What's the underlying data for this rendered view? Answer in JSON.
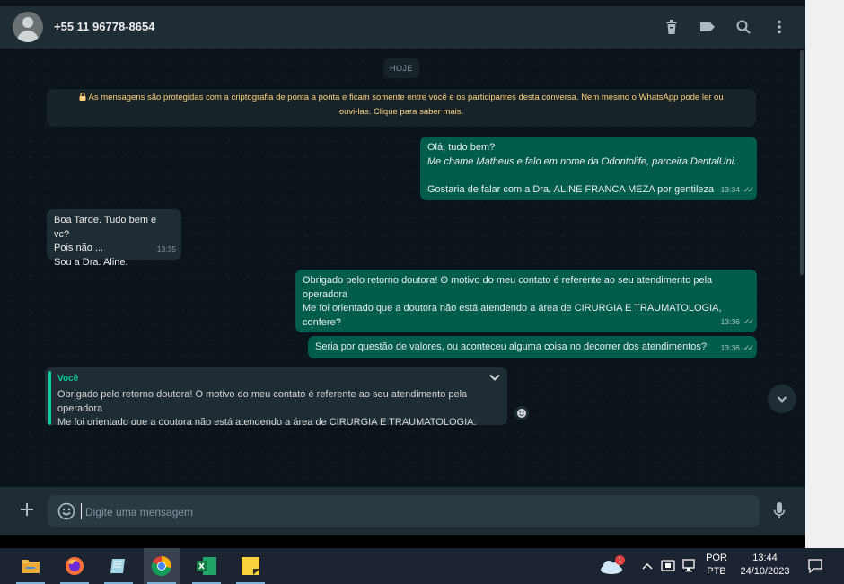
{
  "header": {
    "contact_name": "+55 11 96778-8654",
    "icons": [
      "delete-icon",
      "label-icon",
      "search-icon",
      "menu-icon"
    ]
  },
  "chat": {
    "day_chip": "HOJE",
    "encryption_notice_line1": "As mensagens são protegidas com a criptografia de ponta a ponta e ficam somente entre você e os participantes desta conversa. Nem mesmo o WhatsApp pode ler ou",
    "encryption_notice_line2": "ouvi-las. Clique para saber mais.",
    "messages": [
      {
        "direction": "out",
        "lines": [
          "Olá, tudo bem?",
          "Me chame Matheus e falo em nome da Odontolife, parceira DentalUni.",
          "",
          "Gostaria de falar com a Dra. ALINE FRANCA MEZA por gentileza"
        ],
        "time": "13:34",
        "status": "read"
      },
      {
        "direction": "in",
        "lines": [
          "Boa Tarde. Tudo bem e vc?",
          "Pois não ...",
          "Sou a Dra. Aline."
        ],
        "time": "13:35"
      },
      {
        "direction": "out",
        "lines": [
          "Obrigado pelo retorno doutora! O motivo do meu contato é referente ao seu atendimento pela",
          "operadora",
          "Me foi orientado que a doutora não está atendendo a área de CIRURGIA E TRAUMATOLOGIA,",
          "confere?"
        ],
        "time": "13:36",
        "status": "read"
      },
      {
        "direction": "out",
        "lines": [
          "Seria por questão de valores, ou aconteceu alguma coisa no decorrer dos atendimentos?"
        ],
        "time": "13:36",
        "status": "read"
      }
    ],
    "reply_preview": {
      "author": "Você",
      "lines": [
        "Obrigado pelo retorno doutora! O motivo do meu contato é referente ao seu atendimento pela",
        "operadora",
        "Me foi orientado que a doutora não está atendendo a área de CIRURGIA E TRAUMATOLOGIA, confere?"
      ]
    }
  },
  "composer": {
    "placeholder": "Digite uma mensagem"
  },
  "taskbar": {
    "apps": [
      "file-explorer",
      "firefox",
      "notepad",
      "chrome",
      "excel",
      "sticky-notes"
    ],
    "weather_badge": "1",
    "language_line1": "POR",
    "language_line2": "PTB",
    "time": "13:44",
    "date": "24/10/2023"
  },
  "colors": {
    "outgoing_bubble": "#005c4b",
    "incoming_bubble": "#202c33",
    "header_bg": "#202c33",
    "chat_bg": "#0b141a",
    "notice_text": "#ffd279",
    "accent": "#06cf9c"
  }
}
